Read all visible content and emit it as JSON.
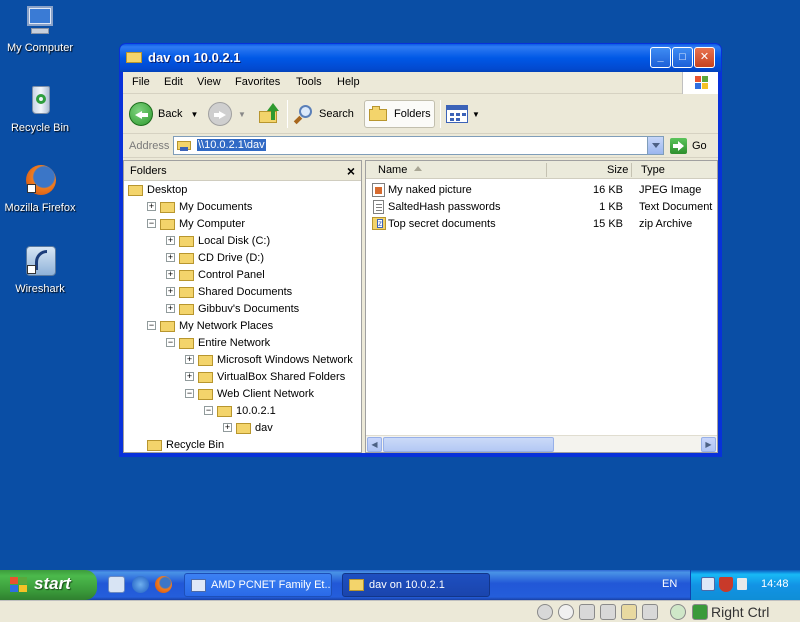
{
  "desktop": {
    "icons": [
      {
        "label": "My Computer"
      },
      {
        "label": "Recycle Bin"
      },
      {
        "label": "Mozilla Firefox"
      },
      {
        "label": "Wireshark"
      }
    ]
  },
  "window": {
    "title": "dav on 10.0.2.1",
    "menu": [
      "File",
      "Edit",
      "View",
      "Favorites",
      "Tools",
      "Help"
    ],
    "toolbar": {
      "back": "Back",
      "search": "Search",
      "folders": "Folders"
    },
    "address": {
      "label": "Address",
      "value": "\\\\10.0.2.1\\dav",
      "go": "Go"
    },
    "folders_pane": {
      "title": "Folders",
      "close": "×",
      "tree": [
        {
          "label": "Desktop",
          "level": 0,
          "exp": ""
        },
        {
          "label": "My Documents",
          "level": 1,
          "exp": "+"
        },
        {
          "label": "My Computer",
          "level": 1,
          "exp": "−"
        },
        {
          "label": "Local Disk (C:)",
          "level": 2,
          "exp": "+"
        },
        {
          "label": "CD Drive (D:)",
          "level": 2,
          "exp": "+"
        },
        {
          "label": "Control Panel",
          "level": 2,
          "exp": "+"
        },
        {
          "label": "Shared Documents",
          "level": 2,
          "exp": "+"
        },
        {
          "label": "Gibbuv's Documents",
          "level": 2,
          "exp": "+"
        },
        {
          "label": "My Network Places",
          "level": 1,
          "exp": "−"
        },
        {
          "label": "Entire Network",
          "level": 2,
          "exp": "−"
        },
        {
          "label": "Microsoft Windows Network",
          "level": 3,
          "exp": "+"
        },
        {
          "label": "VirtualBox Shared Folders",
          "level": 3,
          "exp": "+"
        },
        {
          "label": "Web Client Network",
          "level": 3,
          "exp": "−"
        },
        {
          "label": "10.0.2.1",
          "level": 4,
          "exp": "−"
        },
        {
          "label": "dav",
          "level": 5,
          "exp": "+"
        },
        {
          "label": "Recycle Bin",
          "level": 1,
          "exp": ""
        }
      ]
    },
    "columns": {
      "name": "Name",
      "size": "Size",
      "type": "Type"
    },
    "files": [
      {
        "name": "My naked picture",
        "size": "16 KB",
        "type": "JPEG Image"
      },
      {
        "name": "SaltedHash passwords",
        "size": "1 KB",
        "type": "Text Document"
      },
      {
        "name": "Top secret documents",
        "size": "15 KB",
        "type": "zip Archive"
      }
    ]
  },
  "taskbar": {
    "start": "start",
    "tasks": [
      {
        "label": "AMD PCNET Family Et..."
      },
      {
        "label": "dav on 10.0.2.1"
      }
    ],
    "lang": "EN",
    "clock": "14:48"
  },
  "hostbar": {
    "hostkey": "Right Ctrl"
  }
}
